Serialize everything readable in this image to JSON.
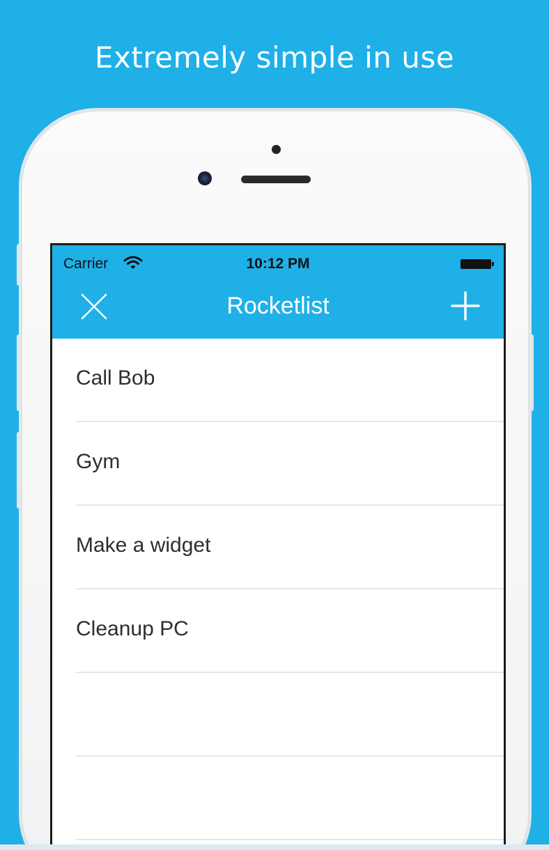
{
  "headline": "Extremely simple in use",
  "colors": {
    "accent": "#1fb0e8",
    "background": "#1fb0e8",
    "list_text": "#2e2e2e",
    "divider": "#e6e6e6"
  },
  "statusbar": {
    "carrier": "Carrier",
    "time": "10:12 PM",
    "wifi_icon": "wifi-icon",
    "battery_icon": "battery-icon"
  },
  "navbar": {
    "title": "Rocketlist",
    "left_icon": "close-icon",
    "right_icon": "plus-icon"
  },
  "list": {
    "items": [
      {
        "label": "Call Bob"
      },
      {
        "label": "Gym"
      },
      {
        "label": "Make a widget"
      },
      {
        "label": "Cleanup PC"
      },
      {
        "label": ""
      },
      {
        "label": ""
      }
    ]
  }
}
